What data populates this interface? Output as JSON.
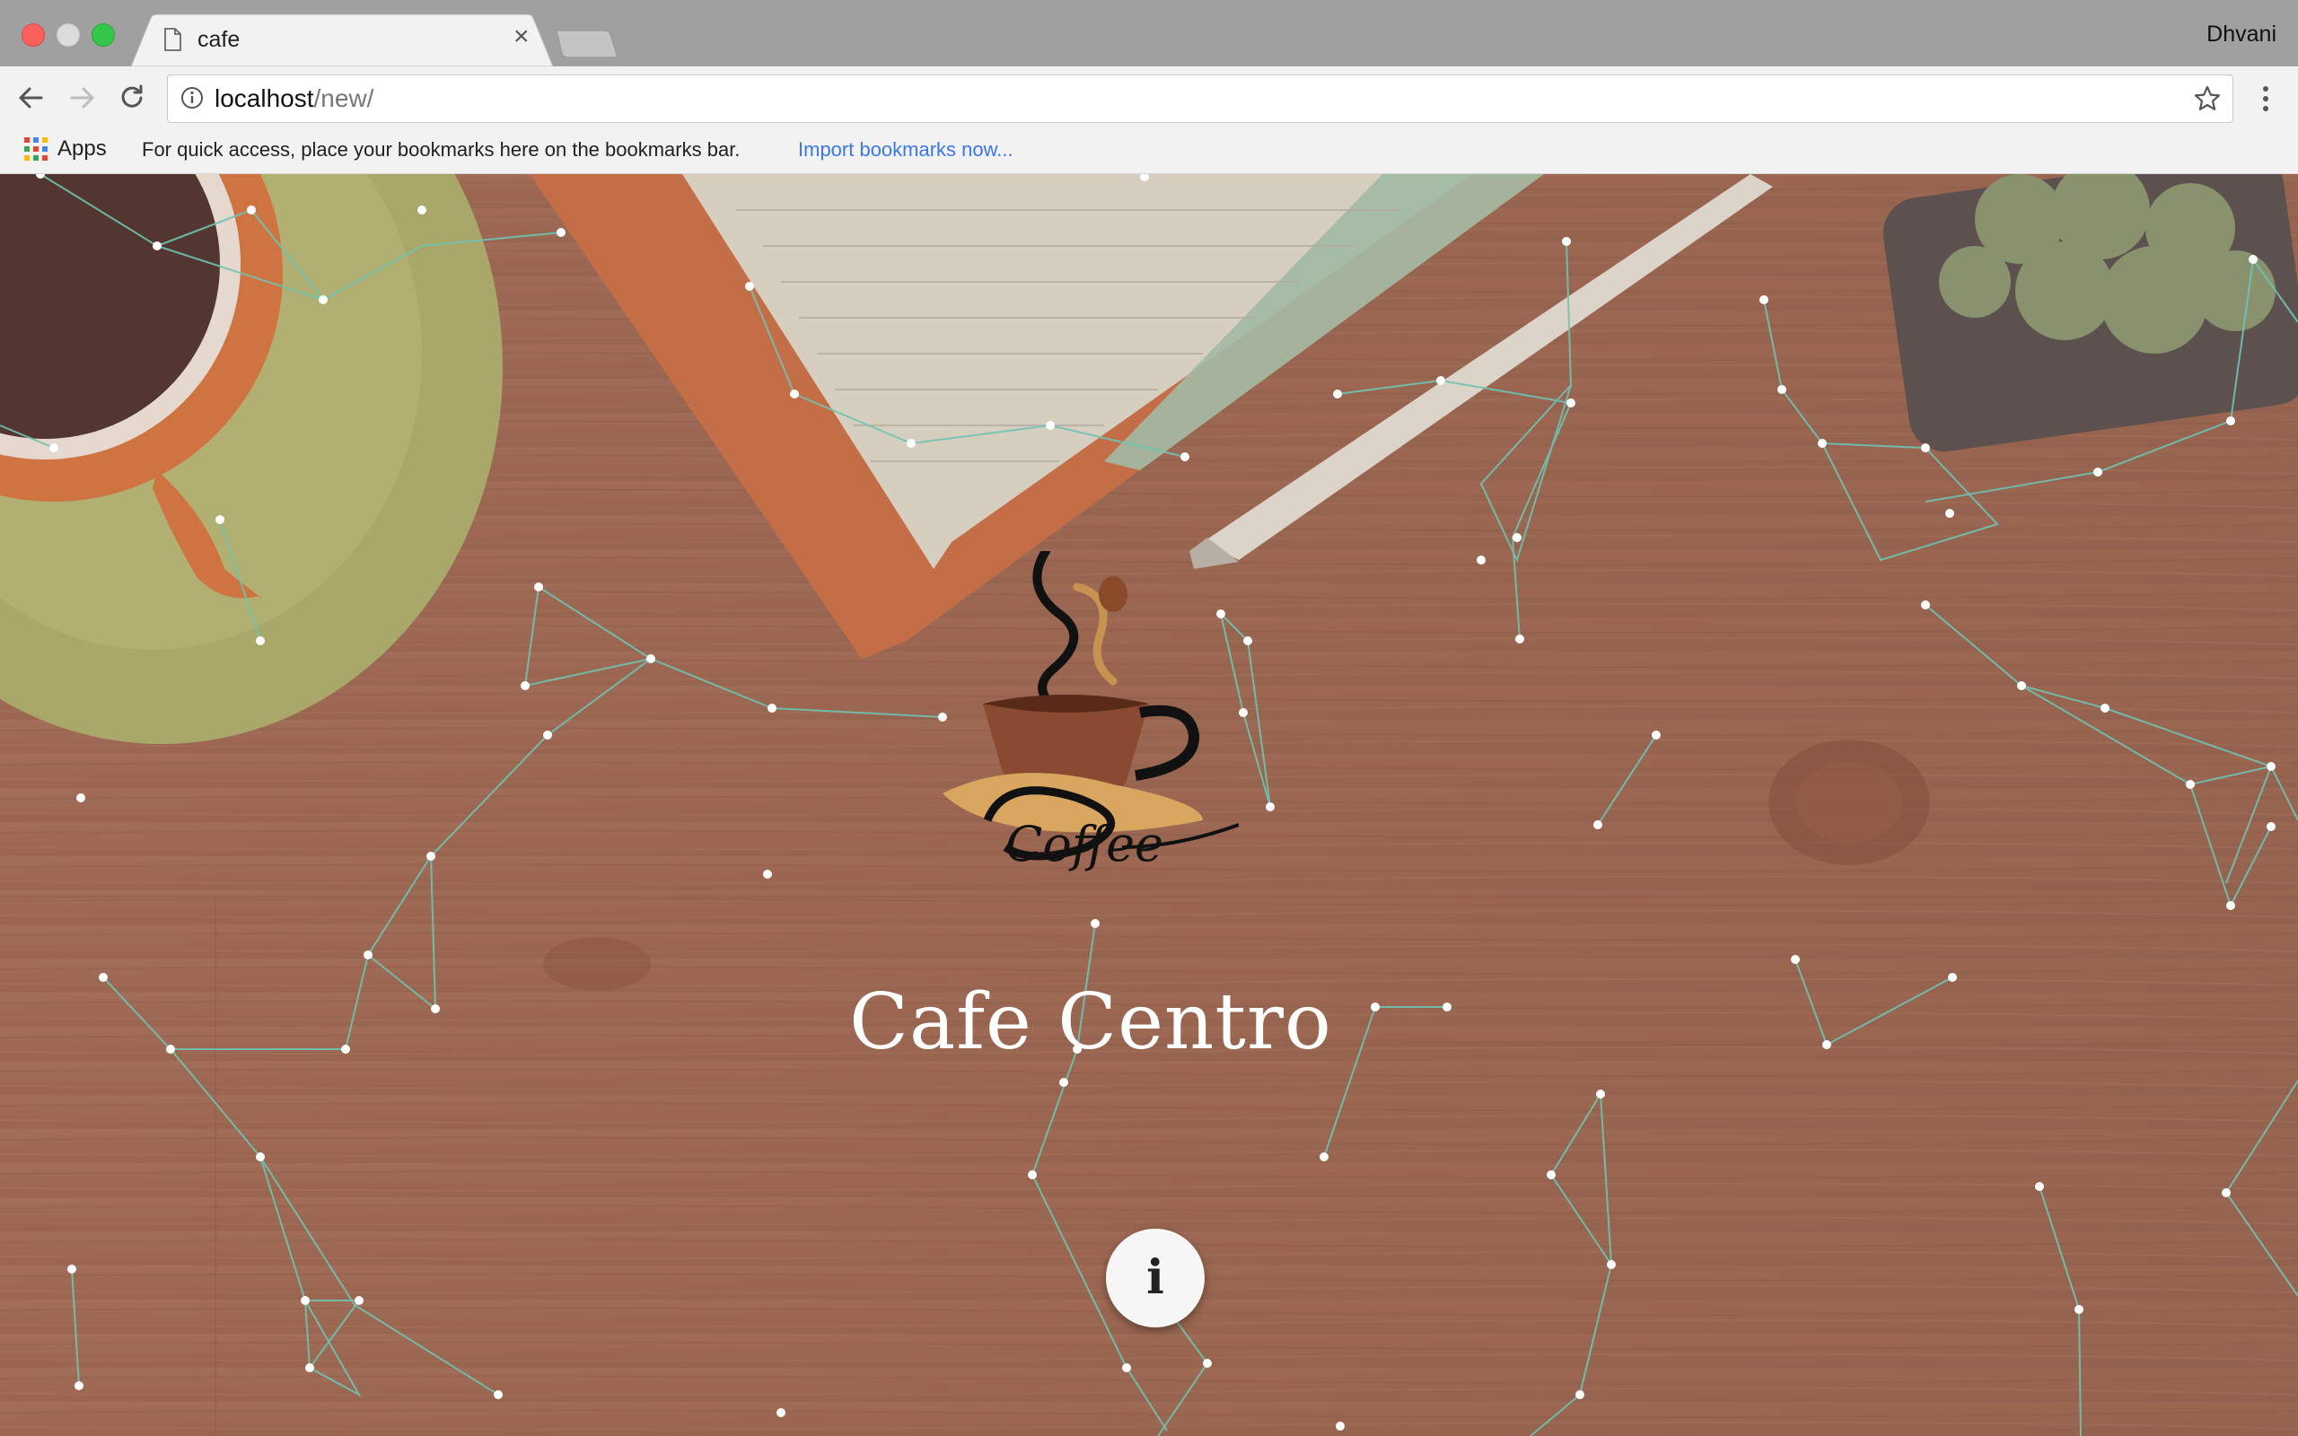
{
  "browser": {
    "tab": {
      "title": "cafe",
      "close_glyph": "×",
      "icon": "document-icon"
    },
    "profile_name": "Dhvani",
    "address": {
      "host": "localhost",
      "path": "/new/"
    },
    "bookmarks_bar": {
      "apps_label": "Apps",
      "message": "For quick access, place your bookmarks here on the bookmarks bar.",
      "import_link": "Import bookmarks now..."
    }
  },
  "page": {
    "title": "Cafe Centro",
    "info_button_label": "i",
    "accent_line_color": "#6fc3b2"
  }
}
